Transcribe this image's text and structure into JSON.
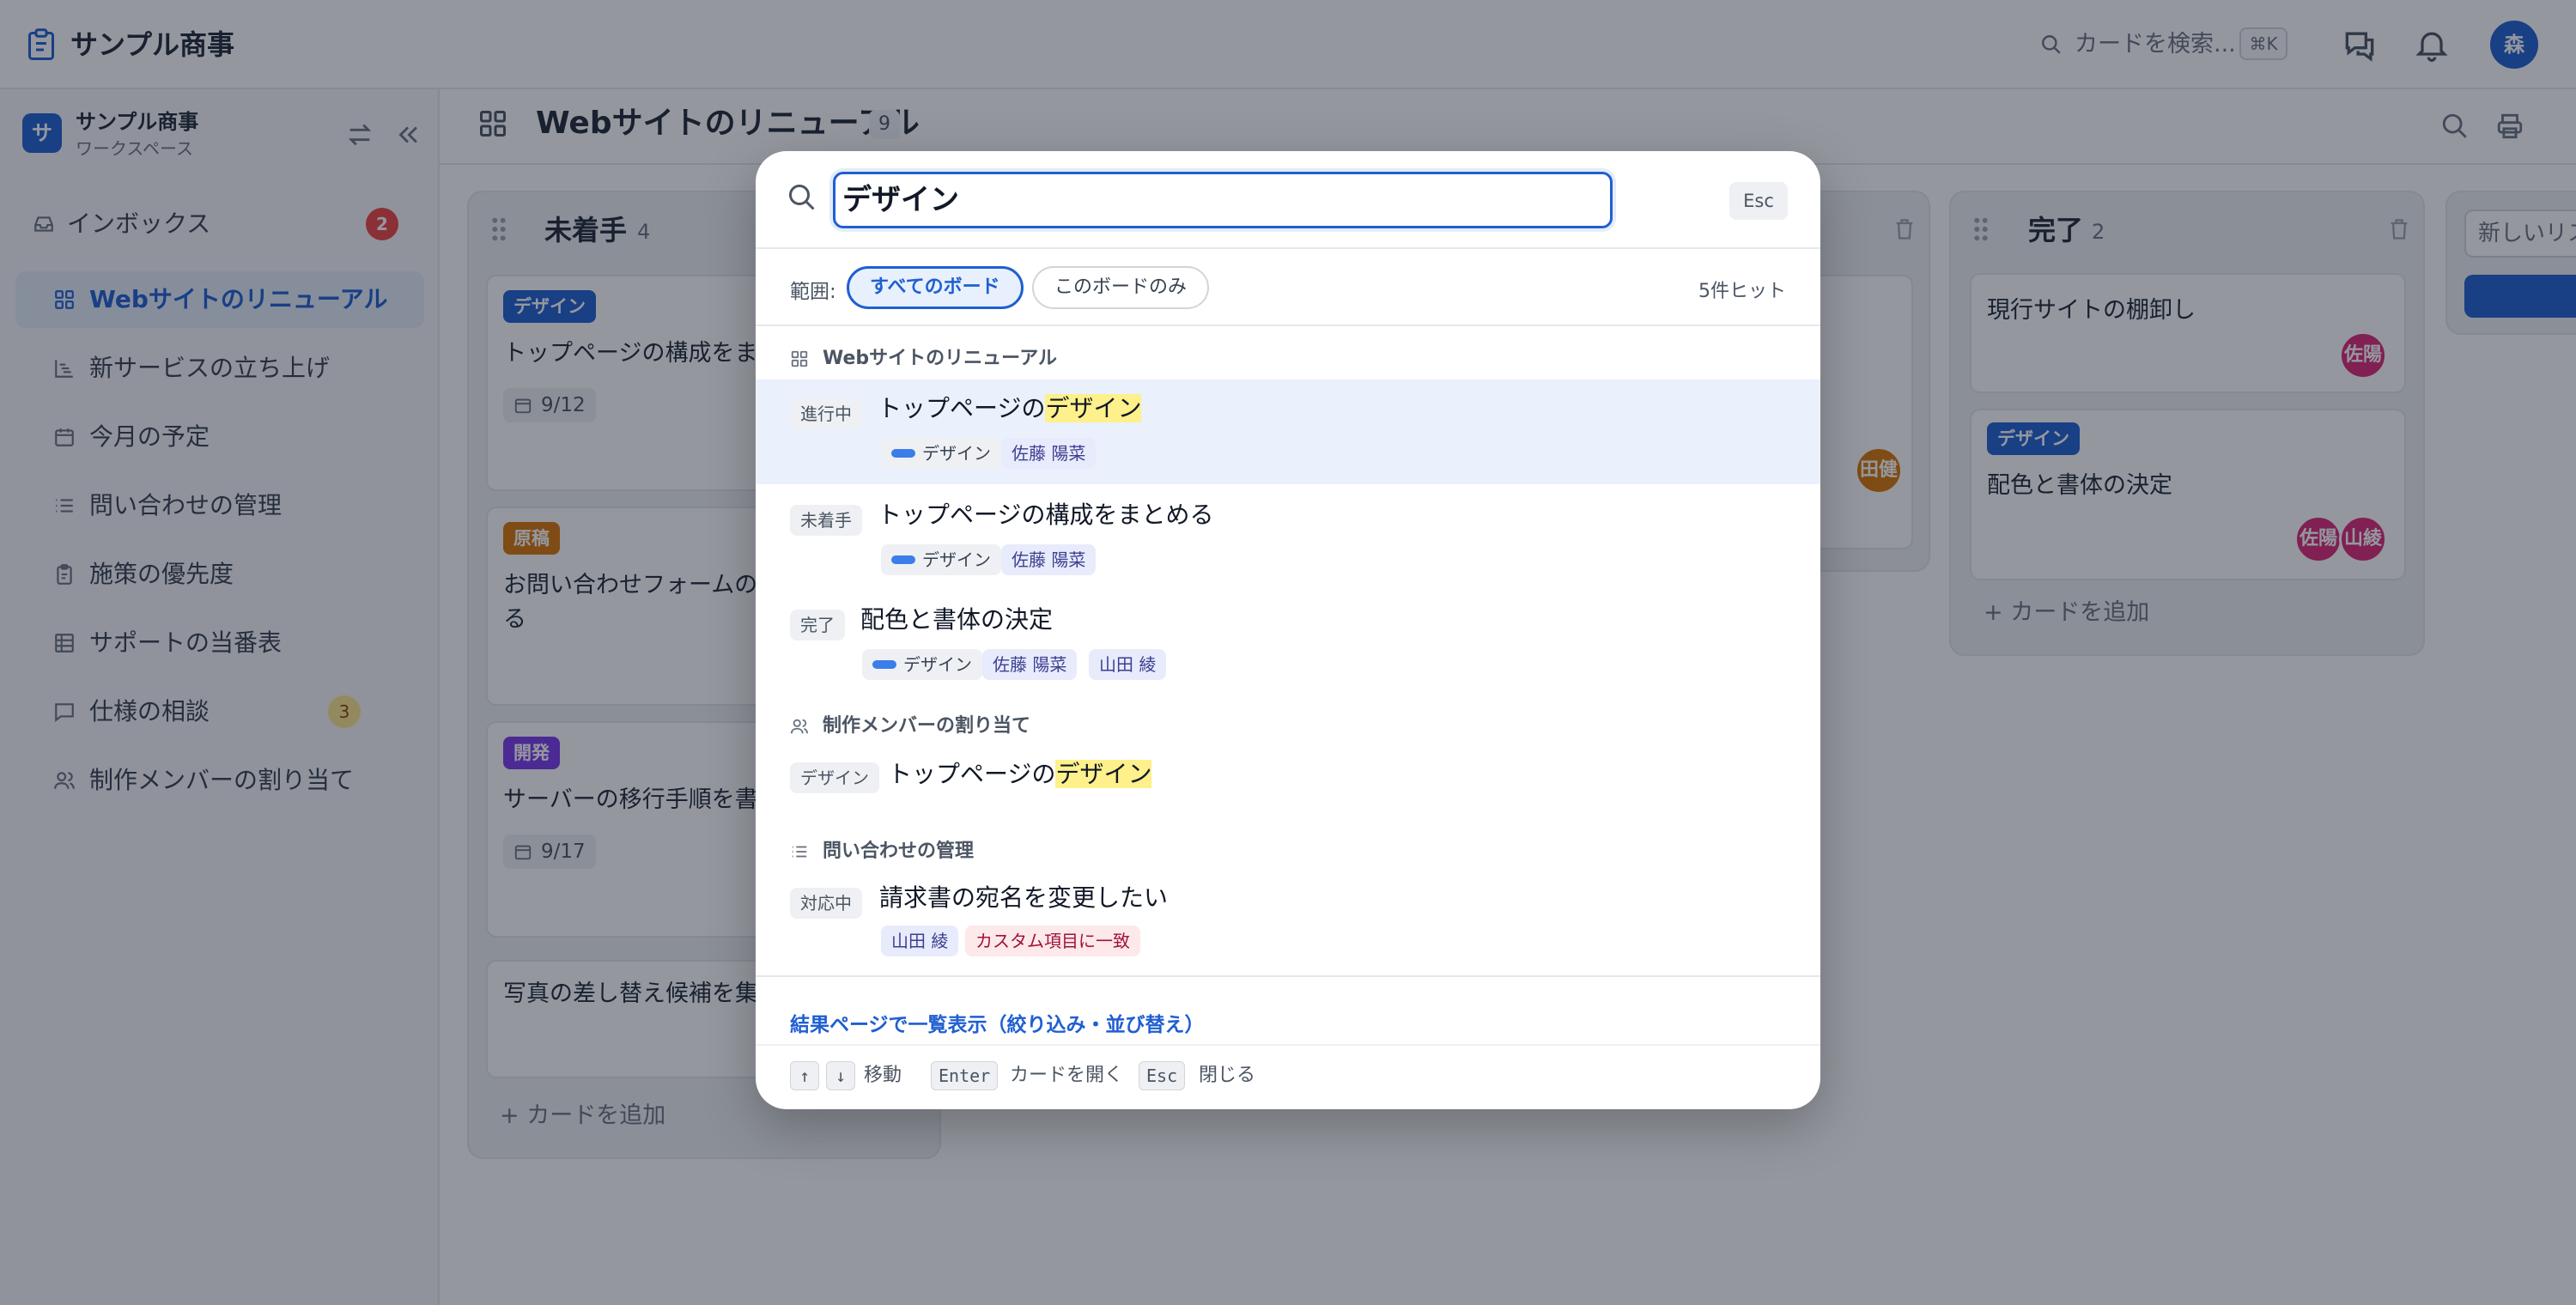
{
  "app": {
    "title": "サンプル商事",
    "user_initial": "森"
  },
  "topbar": {
    "search_placeholder": "カードを検索...",
    "shortcut": "⌘K"
  },
  "workspace": {
    "initial": "サ",
    "name": "サンプル商事",
    "label": "ワークスペース"
  },
  "sidebar": {
    "inbox": {
      "label": "インボックス",
      "badge": "2"
    },
    "items": [
      {
        "label": "Webサイトのリニューアル",
        "icon": "board-icon",
        "active": true
      },
      {
        "label": "新サービスの立ち上げ",
        "icon": "timeline-icon"
      },
      {
        "label": "今月の予定",
        "icon": "calendar-icon"
      },
      {
        "label": "問い合わせの管理",
        "icon": "list-icon"
      },
      {
        "label": "施策の優先度",
        "icon": "clipboard-icon"
      },
      {
        "label": "サポートの当番表",
        "icon": "table-icon"
      },
      {
        "label": "仕様の相談",
        "icon": "chat-icon",
        "badge": "3"
      },
      {
        "label": "制作メンバーの割り当て",
        "icon": "people-icon"
      }
    ]
  },
  "board": {
    "title": "Webサイトのリニューアル",
    "count": "9",
    "columns": {
      "todo": {
        "title": "未着手",
        "count": "4",
        "cards": [
          {
            "tag": "デザイン",
            "title": "トップページの構成をまと",
            "date": "9/12"
          },
          {
            "tag": "原稿",
            "title": "お問い合わせフォームの項",
            "title2": "る"
          },
          {
            "tag": "開発",
            "title": "サーバーの移行手順を書く",
            "date": "9/17"
          },
          {
            "title": "写真の差し替え候補を集め"
          }
        ],
        "add": "+ カードを追加"
      },
      "middle": {
        "avatar": "田健"
      },
      "done": {
        "title": "完了",
        "count": "2",
        "cards": [
          {
            "title": "現行サイトの棚卸し",
            "avatar": "佐陽"
          },
          {
            "tag": "デザイン",
            "title": "配色と書体の決定",
            "avatars": [
              "佐陽",
              "山綾"
            ]
          }
        ],
        "add": "+ カードを追加"
      },
      "new_list": {
        "placeholder": "新しいリス"
      }
    }
  },
  "search_modal": {
    "query": "デザイン",
    "esc": "Esc",
    "scope_label": "範囲:",
    "scope_all": "すべてのボード",
    "scope_this": "このボードのみ",
    "hit_count": "5件ヒット",
    "groups": [
      {
        "name": "Webサイトのリニューアル",
        "results": [
          {
            "status": "進行中",
            "title_pre": "トップページの",
            "title_hl": "デザイン",
            "label": "デザイン",
            "people": [
              "佐藤 陽菜"
            ]
          },
          {
            "status": "未着手",
            "title": "トップページの構成をまとめる",
            "label": "デザイン",
            "people": [
              "佐藤 陽菜"
            ]
          },
          {
            "status": "完了",
            "title": "配色と書体の決定",
            "label": "デザイン",
            "people": [
              "佐藤 陽菜",
              "山田 綾"
            ]
          }
        ]
      },
      {
        "name": "制作メンバーの割り当て",
        "results": [
          {
            "status": "デザイン",
            "title_pre": "トップページの",
            "title_hl": "デザイン"
          }
        ]
      },
      {
        "name": "問い合わせの管理",
        "results": [
          {
            "status": "対応中",
            "title": "請求書の宛名を変更したい",
            "people": [
              "山田 綾"
            ],
            "match": "カスタム項目に一致"
          }
        ]
      }
    ],
    "results_link": "結果ページで一覧表示（絞り込み・並び替え）",
    "hints": {
      "up": "↑",
      "down": "↓",
      "move": "移動",
      "enter": "Enter",
      "open": "カードを開く",
      "esc": "Esc",
      "close": "閉じる"
    }
  },
  "colors": {
    "accent": "#1f5fd1",
    "tag_design": "#1f5fd1",
    "tag_draft": "#d97706",
    "tag_dev": "#7c3aed",
    "avatar_pink": "#db2777",
    "avatar_orange": "#d97706"
  }
}
